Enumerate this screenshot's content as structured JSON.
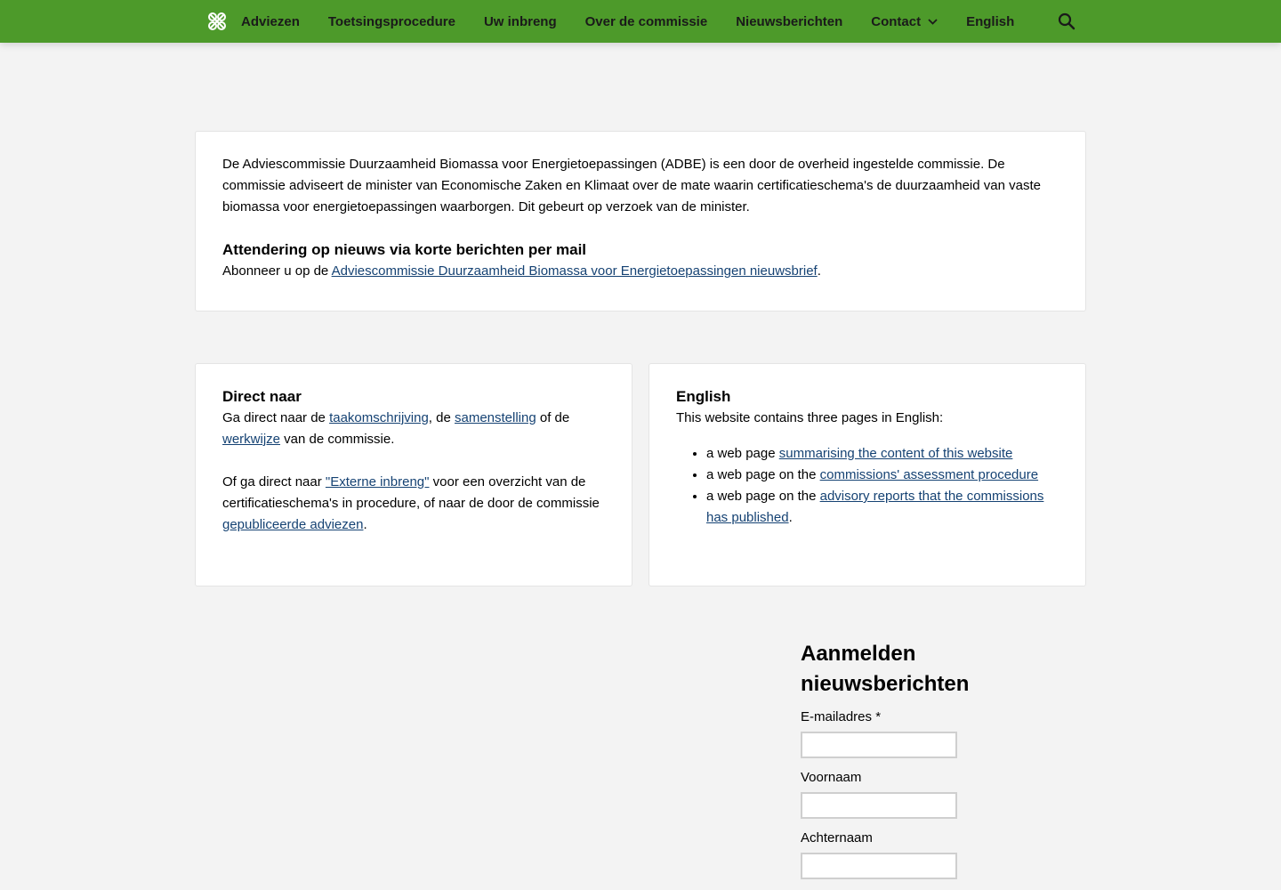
{
  "colors": {
    "header_bg": "#4d9a2a",
    "link": "#154273",
    "page_bg": "#f3f3f3"
  },
  "header": {
    "logo_icon": "commission-logo-icon",
    "nav": [
      {
        "label": "Adviezen"
      },
      {
        "label": "Toetsingsprocedure"
      },
      {
        "label": "Uw inbreng"
      },
      {
        "label": "Over de commissie"
      },
      {
        "label": "Nieuwsberichten"
      },
      {
        "label": "Contact"
      },
      {
        "label": "English"
      }
    ],
    "search_icon": "search-icon"
  },
  "intro": {
    "text": "De Adviescommissie Duurzaamheid Biomassa voor Energietoepassingen (ADBE) is een door de overheid ingestelde commissie. De commissie adviseert de minister van Economische Zaken en Klimaat over de mate waarin certificatieschema's de duurzaamheid van vaste biomassa voor energietoepassingen waarborgen. Dit gebeurt op verzoek van de minister.",
    "heading": "Attendering op nieuws via korte berichten per mail",
    "subscribe_prefix": "Abonneer u op de ",
    "subscribe_link": "Adviescommissie Duurzaamheid Biomassa voor Energietoepassingen nieuwsbrief",
    "subscribe_suffix": "."
  },
  "direct": {
    "heading": "Direct naar",
    "p1_a": "Ga direct naar de ",
    "link_taak": "taakomschrijving",
    "p1_b": ", de ",
    "link_samen": "samenstelling",
    "p1_c": " of de ",
    "link_werk": "werkwijze",
    "p1_d": " van de commissie.",
    "p2_a": "Of ga direct naar ",
    "link_extern": "\"Externe inbreng\"",
    "p2_b": " voor een overzicht van de certificatieschema's in procedure, of naar de door de commissie ",
    "link_adviezen": "gepubliceerde adviezen",
    "p2_c": "."
  },
  "english": {
    "heading": "English",
    "text": "This website contains three pages in English:",
    "items": [
      {
        "prefix": "a web page ",
        "link": "summarising the content of this website",
        "suffix": ""
      },
      {
        "prefix": "a web page on the ",
        "link": "commissions' assessment procedure",
        "suffix": ""
      },
      {
        "prefix": "a web page on the ",
        "link": "advisory reports that the commissions has published",
        "suffix": "."
      }
    ]
  },
  "newsletter": {
    "heading": "Aanmelden nieuwsberichten",
    "fields": [
      {
        "label": "E-mailadres *",
        "value": ""
      },
      {
        "label": "Voornaam",
        "value": ""
      },
      {
        "label": "Achternaam",
        "value": ""
      }
    ]
  }
}
